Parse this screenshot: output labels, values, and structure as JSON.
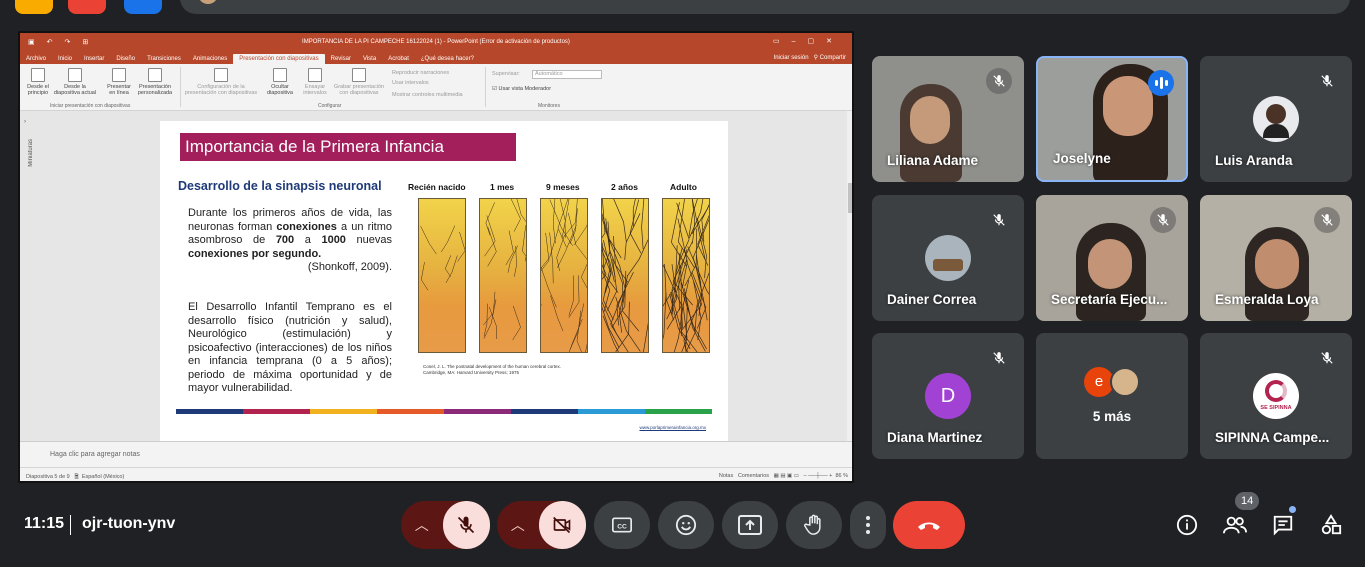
{
  "presentation": {
    "window_title": "IMPORTANCIA DE LA PI CAMPECHE 16122024 (1) - PowerPoint (Error de activación de productos)",
    "tabs": [
      {
        "label": "Archivo"
      },
      {
        "label": "Inicio"
      },
      {
        "label": "Insertar"
      },
      {
        "label": "Diseño"
      },
      {
        "label": "Transiciones"
      },
      {
        "label": "Animaciones"
      },
      {
        "label": "Presentación con diapositivas"
      },
      {
        "label": "Revisar"
      },
      {
        "label": "Vista"
      },
      {
        "label": "Acrobat"
      },
      {
        "label": "¿Qué desea hacer?"
      }
    ],
    "signin": "Iniciar sesión",
    "share": "Compartir",
    "ribbon": {
      "desde_principio": "Desde el principio",
      "desde_actual": "Desde la diapositiva actual",
      "en_linea": "Presentar en línea",
      "personalizada": "Presentación personalizada",
      "group_iniciar": "Iniciar presentación con diapositivas",
      "configuracion": "Configuración de la presentación con diapositivas",
      "ocultar": "Ocultar diapositiva",
      "ensayar": "Ensayar intervalos",
      "grabar": "Grabar presentación con diapositivas",
      "reproducir": "Reproducir narraciones",
      "usar_intervalos": "Usar intervalos",
      "mostrar_controles": "Mostrar controles multimedia",
      "group_configurar": "Configurar",
      "supervisar": "Supervisar:",
      "supervisar_value": "Automático",
      "vista_moderador": "Usar vista Moderador",
      "group_monitores": "Monitores"
    },
    "side_label": "Miniaturas",
    "slide": {
      "title": "Importancia de la Primera Infancia",
      "subtitle": "Desarrollo de la sinapsis neuronal",
      "p1_a": "Durante los primeros años de vida, las neuronas forman ",
      "p1_b": "conexiones",
      "p1_c": " a un ritmo asombroso de ",
      "p1_d": "700",
      "p1_e": " a ",
      "p1_f": "1000",
      "p1_g": " nuevas ",
      "p1_h": "conexiones por segundo.",
      "p1_cite": "(Shonkoff, 2009).",
      "p2": "El Desarrollo Infantil Temprano es el desarrollo físico (nutrición y salud), Neurológico (estimulación) y psicoafectivo (interacciones) de los niños en infancia temprana (0 a 5 años); periodo de máxima oportunidad y de mayor vulnerabilidad.",
      "stages": [
        "Recién nacido",
        "1 mes",
        "9 meses",
        "2 años",
        "Adulto"
      ],
      "fig_cite_1": "Conel, J. L. The postnatal development of the human cerebral cortex.",
      "fig_cite_2": "Cambridge, MA: Harvard University Press; 1975",
      "url": "www.porlaprimerainfancia.org.mx"
    },
    "notes_placeholder": "Haga clic para agregar notas",
    "status_left": "Diapositiva 5 de 9",
    "status_lang": "Español (México)",
    "status_notas": "Notas",
    "status_comentarios": "Comentarios",
    "zoom": "86 %"
  },
  "participants": [
    {
      "name": "Liliana Adame",
      "type": "video",
      "muted": true
    },
    {
      "name": "Joselyne",
      "type": "video",
      "speaking": true
    },
    {
      "name": "Luis Aranda",
      "type": "avatar",
      "muted": true
    },
    {
      "name": "Dainer Correa",
      "type": "avatar",
      "muted": true
    },
    {
      "name": "Secretaría Ejecu...",
      "type": "video",
      "muted": true
    },
    {
      "name": "Esmeralda Loya",
      "type": "video",
      "muted": true
    },
    {
      "name": "Diana Martinez",
      "type": "letter",
      "letter": "D",
      "muted": true
    },
    {
      "name": "5 más",
      "type": "more",
      "letter": "e"
    },
    {
      "name": "SIPINNA Campe...",
      "type": "logo",
      "logo_text": "SE SIPINNA",
      "muted": true
    }
  ],
  "meeting": {
    "time": "11:15",
    "code": "ojr-tuon-ynv",
    "participant_count": "14"
  },
  "colors": {
    "accent": "#8ab4f8",
    "end_call": "#ea4335",
    "mic_off_bg": "#f9dedc",
    "slide_title_bg": "#a31f5b"
  }
}
